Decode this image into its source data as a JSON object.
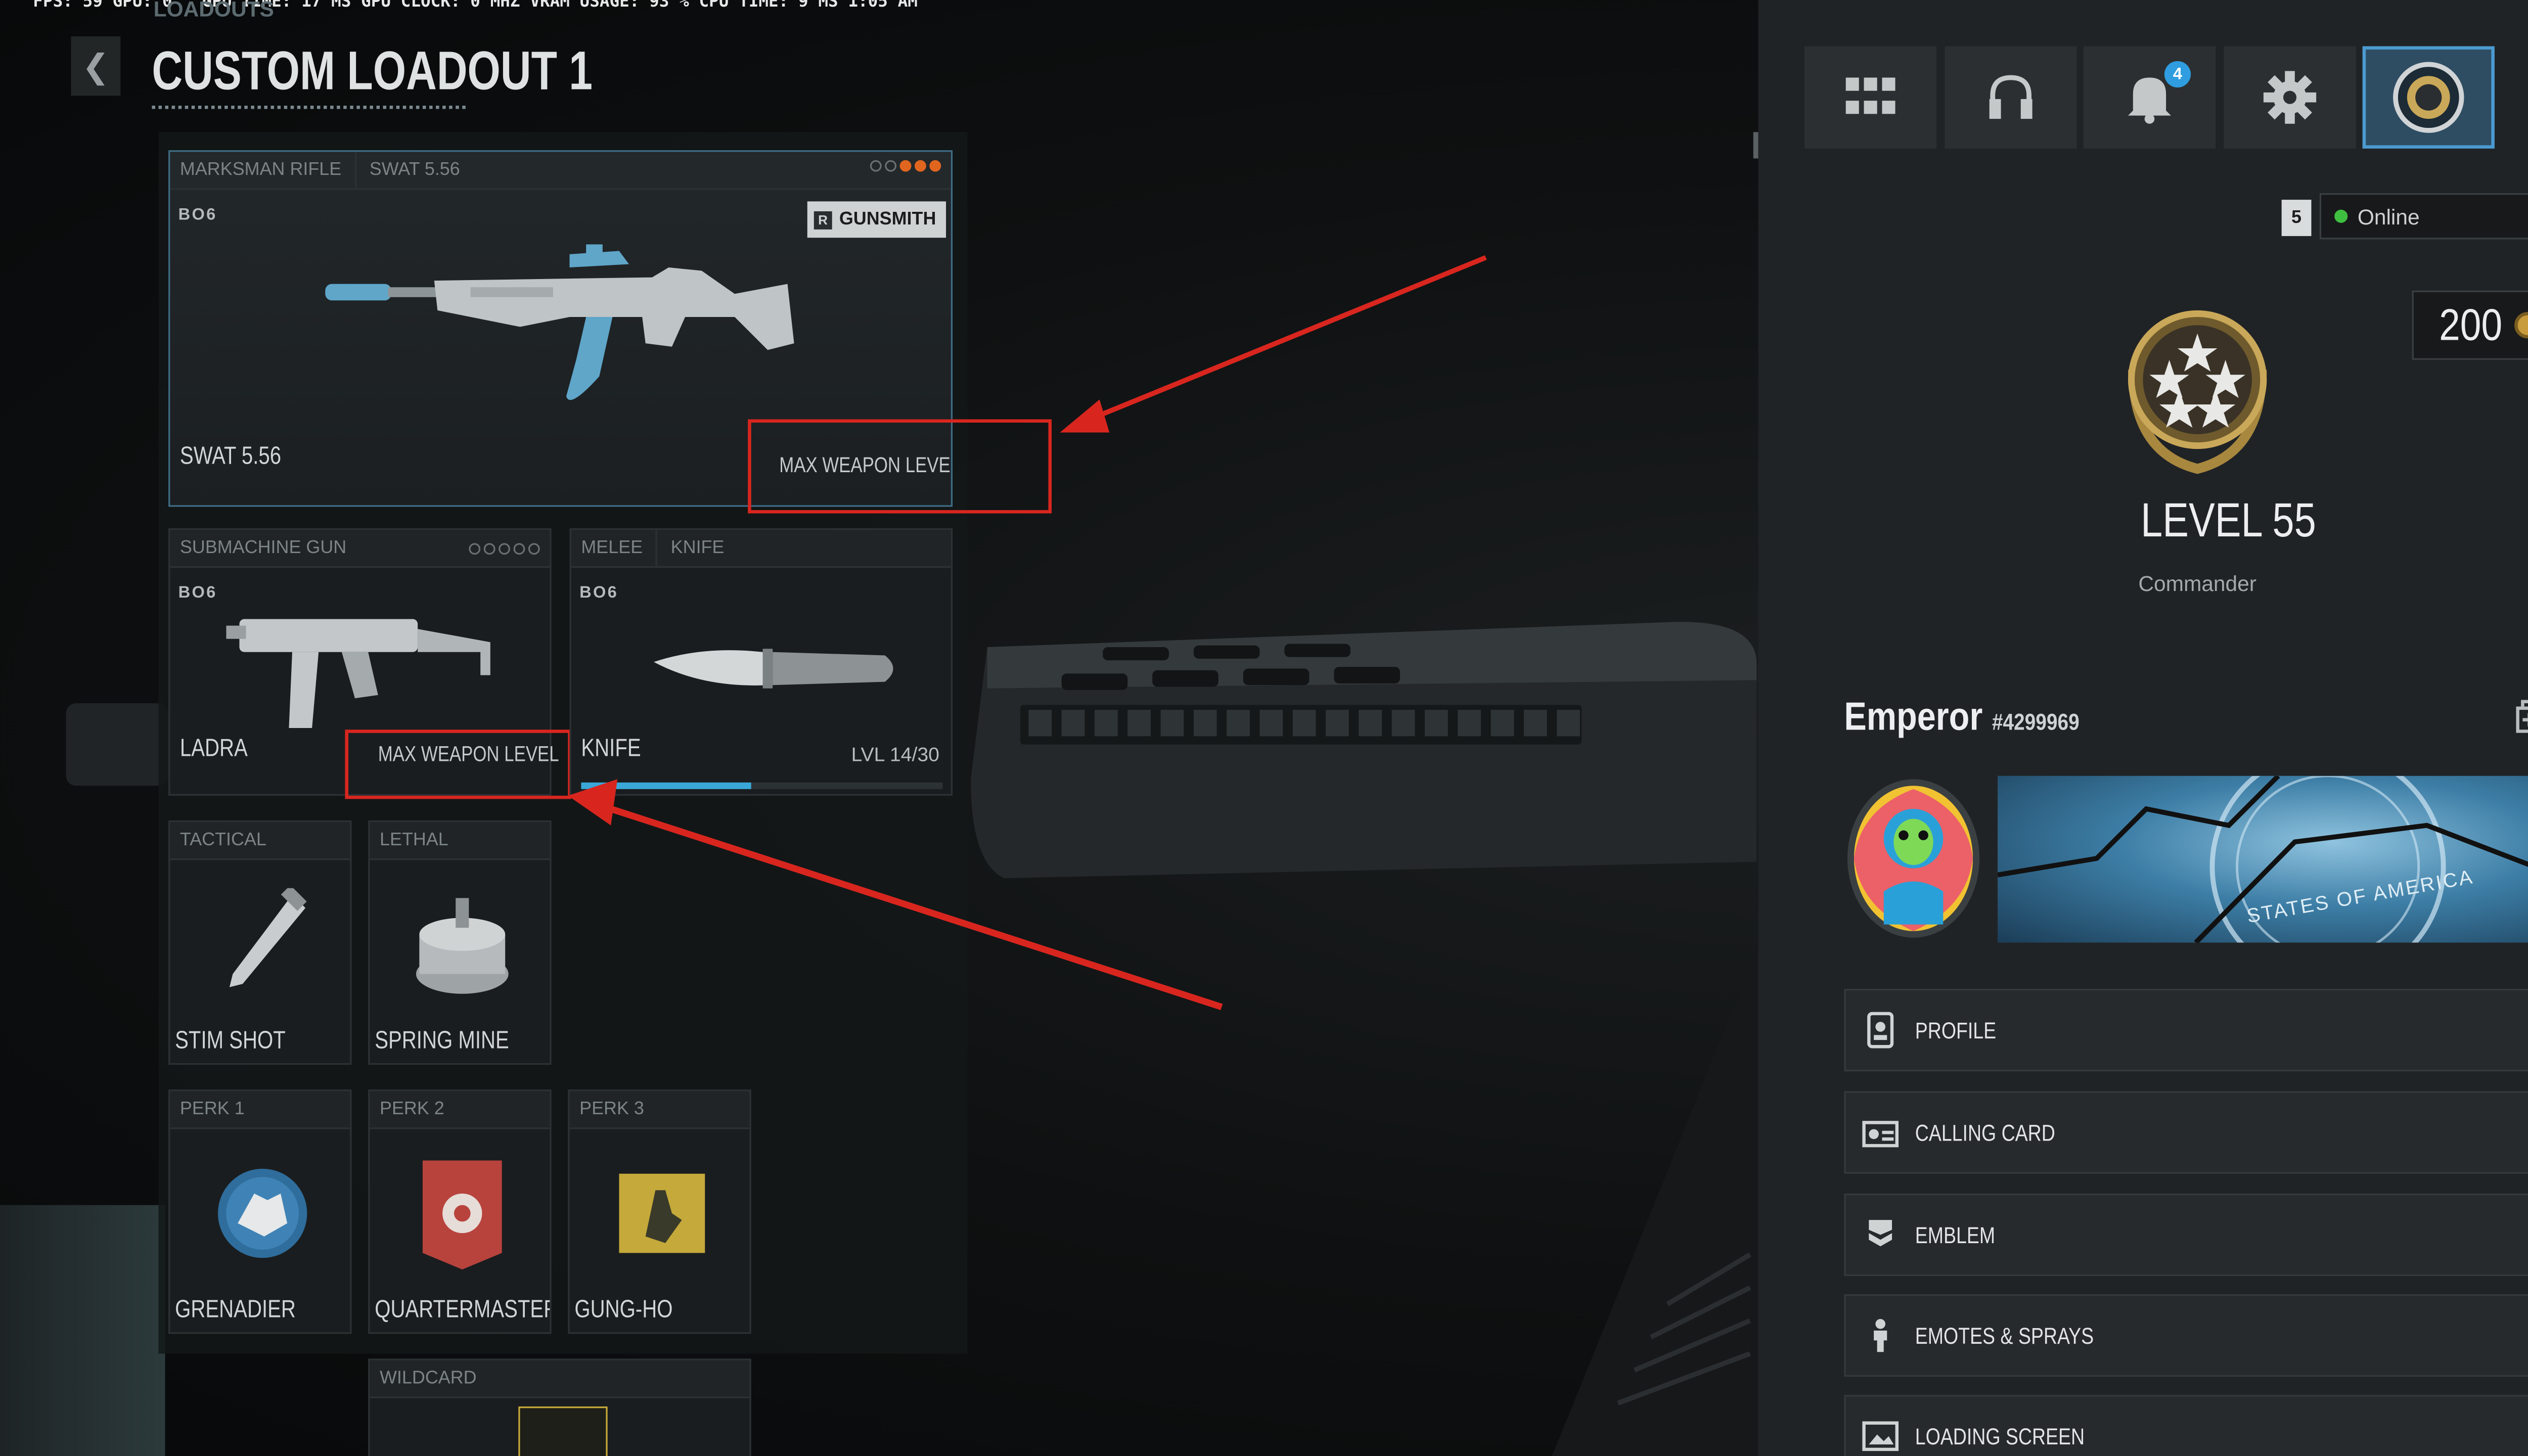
{
  "perf_overlay": "FPS:  59  GPU: 0 °  GPU TIME: 17 MS  GPU CLOCK: 0 MHZ  VRAM USAGE: 93 %  CPU TIME:  9 MS  1:05 AM",
  "header": {
    "breadcrumb": "LOADOUTS",
    "title": "CUSTOM LOADOUT 1",
    "back_glyph": "❮"
  },
  "primary": {
    "category": "MARKSMAN RIFLE",
    "weapon": "SWAT 5.56",
    "game_tag": "BO6",
    "gunsmith_key": "R",
    "gunsmith_label": "GUNSMITH",
    "name": "SWAT 5.56",
    "status": "MAX WEAPON LEVEL",
    "progress_dots": [
      false,
      false,
      true,
      true,
      true
    ]
  },
  "secondary": {
    "category": "SUBMACHINE GUN",
    "game_tag": "BO6",
    "name": "LADRA",
    "status": "MAX WEAPON LEVEL",
    "progress_dots": [
      false,
      false,
      false,
      false,
      false
    ]
  },
  "melee": {
    "category": "MELEE",
    "weapon": "KNIFE",
    "game_tag": "BO6",
    "name": "KNIFE",
    "level_text": "LVL 14/30",
    "level_progress": 0.47
  },
  "tactical": {
    "category": "TACTICAL",
    "name": "STIM SHOT"
  },
  "lethal": {
    "category": "LETHAL",
    "name": "SPRING MINE"
  },
  "perks": [
    {
      "slot": "PERK 1",
      "name": "GRENADIER"
    },
    {
      "slot": "PERK 2",
      "name": "QUARTERMASTER"
    },
    {
      "slot": "PERK 3",
      "name": "GUNG-HO"
    }
  ],
  "wildcard": {
    "slot": "WILDCARD"
  },
  "topbar": {
    "icons": [
      "grid-icon",
      "headset-icon",
      "bell-icon",
      "gear-icon",
      "profile-badge-icon"
    ],
    "notification_count": "4"
  },
  "status": {
    "party_count": "5",
    "presence": "Online"
  },
  "currency": {
    "cod_points": "200"
  },
  "player": {
    "level": "LEVEL 55",
    "rank": "Commander",
    "name": "Emperor",
    "tag": "#4299969"
  },
  "calling_card_text": "STATES OF AMERICA",
  "menu": [
    {
      "label": "PROFILE",
      "icon": "profile-icon"
    },
    {
      "label": "CALLING CARD",
      "icon": "calling-card-icon"
    },
    {
      "label": "EMBLEM",
      "icon": "emblem-icon"
    },
    {
      "label": "EMOTES & SPRAYS",
      "icon": "emote-icon"
    },
    {
      "label": "LOADING SCREEN",
      "icon": "loading-screen-icon"
    }
  ],
  "colors": {
    "accent_blue": "#4b9bd0",
    "annotation_red": "#d8261f",
    "online_green": "#3fbf3f",
    "progress_orange": "#e0651f"
  }
}
